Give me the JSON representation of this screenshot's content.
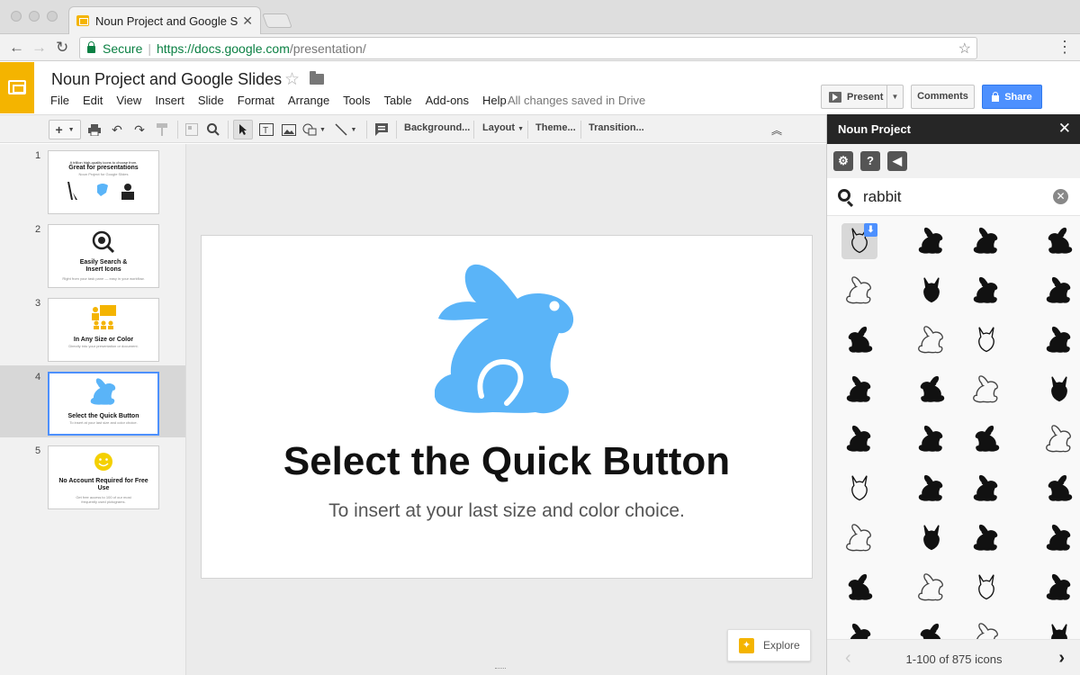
{
  "browser": {
    "tab_title": "Noun Project and Google Slide",
    "secure_label": "Secure",
    "url_host": "https://docs.google.com",
    "url_path": "/presentation/"
  },
  "doc": {
    "title": "Noun Project and Google Slides",
    "menu": [
      "File",
      "Edit",
      "View",
      "Insert",
      "Slide",
      "Format",
      "Arrange",
      "Tools",
      "Table",
      "Add-ons",
      "Help"
    ],
    "save_status": "All changes saved in Drive",
    "present_label": "Present",
    "comments_label": "Comments",
    "share_label": "Share"
  },
  "toolbar": {
    "background": "Background...",
    "layout": "Layout",
    "theme": "Theme...",
    "transition": "Transition..."
  },
  "slides": [
    {
      "num": "1",
      "caption": "A trillion high-quality icons to choose from.",
      "title": "Great for presentations",
      "sub": "Noun Project for Google Slides"
    },
    {
      "num": "2",
      "title": "Easily Search & Insert Icons",
      "sub": "Right from your task pane — easy in your workflow."
    },
    {
      "num": "3",
      "title": "In Any Size or Color",
      "sub": "Directly into your presentation or document."
    },
    {
      "num": "4",
      "title": "Select the Quick Button",
      "sub": "To insert at your last size and color choice."
    },
    {
      "num": "5",
      "title": "No Account Required for Free Use",
      "sub": "Get free access to 100 of our most frequently used pictograms."
    }
  ],
  "current_slide": {
    "title": "Select the Quick Button",
    "subtitle": "To insert at your last size and color choice.",
    "icon": "rabbit-icon",
    "icon_color": "#5ab4f8"
  },
  "explore_label": "Explore",
  "panel": {
    "title": "Noun Project",
    "search_value": "rabbit",
    "pagination": "1-100 of 875 icons",
    "icon_count_visible": 36
  },
  "colors": {
    "accent": "#4d90fe",
    "slides_brand": "#f4b400",
    "secure_green": "#0b8043"
  }
}
